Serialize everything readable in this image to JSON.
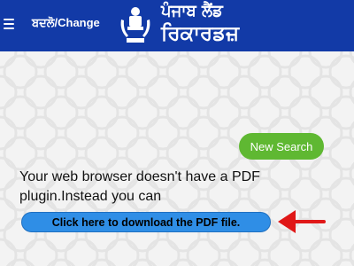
{
  "header": {
    "language_toggle": "ਬਦਲੋ/Change",
    "brand_line1": "ਪੰਜਾਬ ਲੈਂਡ",
    "brand_line2": "ਰਿਕਾਰਡਜ਼",
    "background_color": "#123aa7",
    "emblem_icon": "state-emblem-icon",
    "menu_icon": "hamburger-menu-icon"
  },
  "main": {
    "new_search_label": "New Search",
    "message": "Your web browser doesn't have a PDF plugin.Instead you can",
    "download_label": "Click here to download the PDF file.",
    "accent_color": "#5fb832",
    "link_color": "#2f8ee6",
    "arrow_icon": "red-arrow-left-icon"
  }
}
